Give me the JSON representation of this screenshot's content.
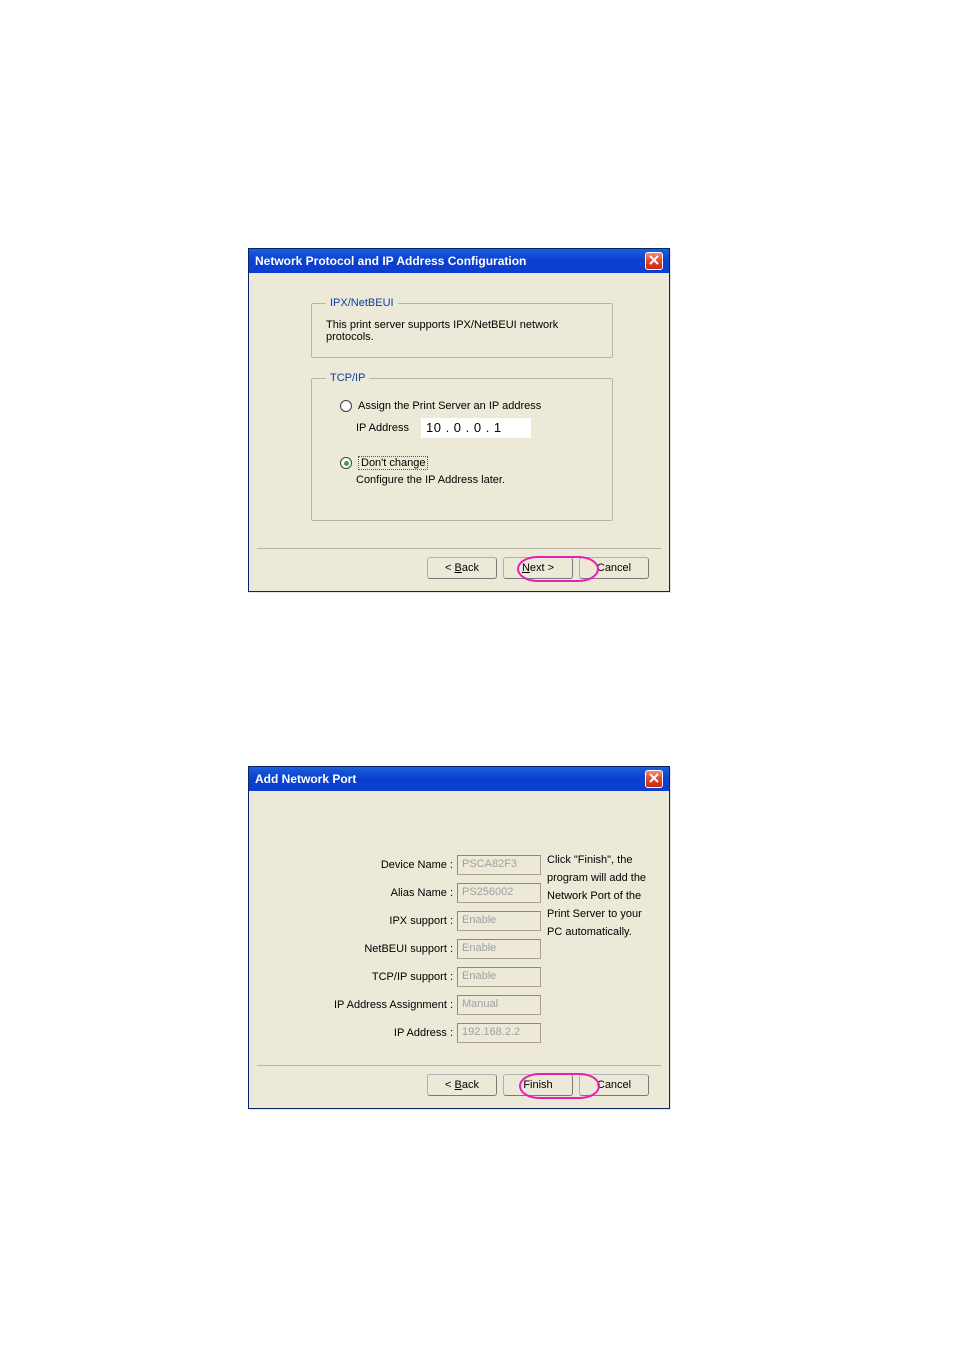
{
  "dialog1": {
    "title": "Network Protocol and IP Address Configuration",
    "groups": {
      "ipxnetbeui": {
        "legend": "IPX/NetBEUI",
        "text": "This print server supports IPX/NetBEUI network protocols."
      },
      "tcpip": {
        "legend": "TCP/IP",
        "assign_label": "Assign the Print Server an IP address",
        "ip_label": "IP Address",
        "ip_value": "10 . 0 . 0 . 1",
        "dont_change_label": "Don't change",
        "configure_later_label": "Configure the IP Address later."
      }
    },
    "buttons": {
      "back_prefix": "< ",
      "back_u": "B",
      "back_rest": "ack",
      "next_u": "N",
      "next_rest": "ext >",
      "cancel": "Cancel"
    }
  },
  "dialog2": {
    "title": "Add Network Port",
    "fields": [
      {
        "label": "Device Name :",
        "value": "PSCA82F3"
      },
      {
        "label": "Alias Name :",
        "value": "PS256002"
      },
      {
        "label": "IPX support :",
        "value": "Enable"
      },
      {
        "label": "NetBEUI support :",
        "value": "Enable"
      },
      {
        "label": "TCP/IP support :",
        "value": "Enable"
      },
      {
        "label": "IP Address Assignment :",
        "value": "Manual"
      },
      {
        "label": "IP Address :",
        "value": "192.168.2.2"
      }
    ],
    "info_text": "Click \"Finish\", the program will add the Network Port of the Print Server to your PC automatically.",
    "buttons": {
      "back_prefix": "< ",
      "back_u": "B",
      "back_rest": "ack",
      "finish": "Finish",
      "cancel": "Cancel"
    }
  }
}
